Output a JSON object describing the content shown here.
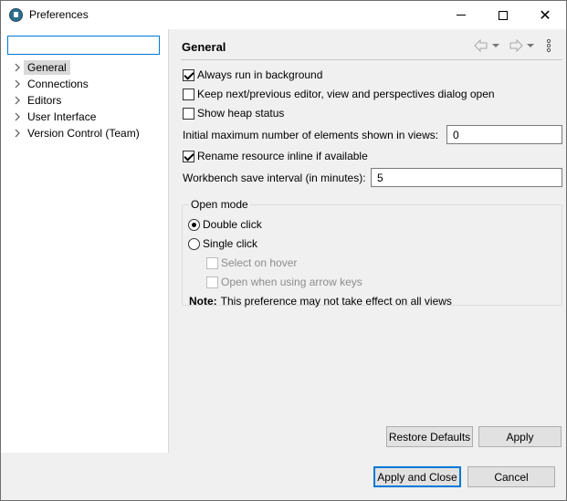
{
  "window": {
    "title": "Preferences",
    "icon": "eclipse-app-icon"
  },
  "sidebar": {
    "filter_value": "",
    "items": [
      {
        "label": "General",
        "selected": true
      },
      {
        "label": "Connections",
        "selected": false
      },
      {
        "label": "Editors",
        "selected": false
      },
      {
        "label": "User Interface",
        "selected": false
      },
      {
        "label": "Version Control (Team)",
        "selected": false
      }
    ]
  },
  "page": {
    "title": "General",
    "options": {
      "always_run_background": {
        "label": "Always run in background",
        "checked": true
      },
      "keep_dialog_open": {
        "label": "Keep next/previous editor, view and perspectives dialog open",
        "checked": false
      },
      "show_heap": {
        "label": "Show heap status",
        "checked": false
      },
      "rename_inline": {
        "label": "Rename resource inline if available",
        "checked": true
      }
    },
    "max_elements": {
      "label": "Initial maximum number of elements shown in views:",
      "value": "0"
    },
    "save_interval": {
      "label": "Workbench save interval (in minutes):",
      "value": "5"
    },
    "open_mode": {
      "title": "Open mode",
      "double_click": {
        "label": "Double click",
        "selected": true
      },
      "single_click": {
        "label": "Single click",
        "selected": false
      },
      "select_on_hover": {
        "label": "Select on hover",
        "checked": false,
        "enabled": false
      },
      "open_arrow_keys": {
        "label": "Open when using arrow keys",
        "checked": false,
        "enabled": false
      },
      "note_label": "Note:",
      "note_text": "This preference may not take effect on all views"
    }
  },
  "buttons": {
    "restore_defaults": "Restore Defaults",
    "apply": "Apply",
    "apply_close": "Apply and Close",
    "cancel": "Cancel"
  }
}
